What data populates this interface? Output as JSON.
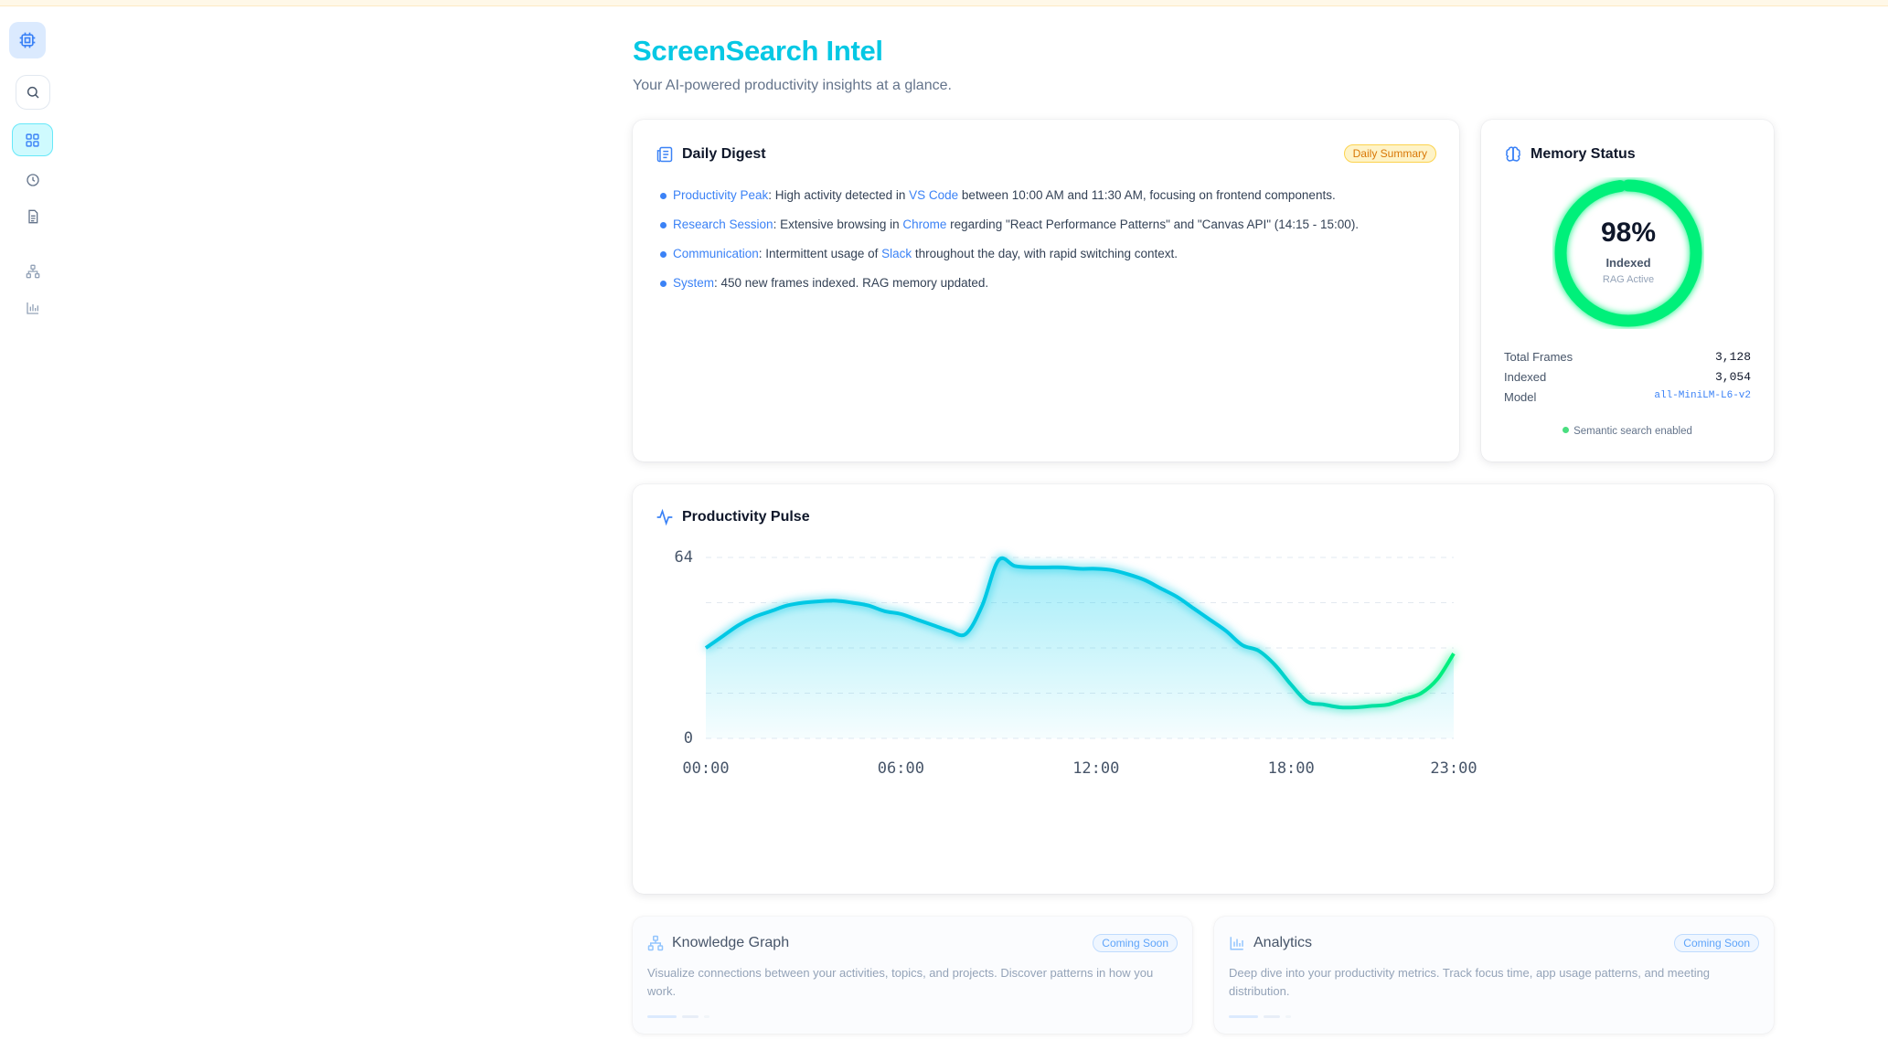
{
  "app": {
    "title": "ScreenSearch Intel",
    "subtitle": "Your AI-powered productivity insights at a glance."
  },
  "sidebar": {
    "items": [
      {
        "name": "logo",
        "icon": "chip-icon"
      },
      {
        "name": "search",
        "icon": "search-icon"
      },
      {
        "name": "dashboard",
        "icon": "grid-icon",
        "active": true
      },
      {
        "name": "history",
        "icon": "clock-icon"
      },
      {
        "name": "documents",
        "icon": "document-icon"
      },
      {
        "name": "knowledge-graph",
        "icon": "graph-icon"
      },
      {
        "name": "analytics",
        "icon": "bar-chart-icon"
      }
    ]
  },
  "digest": {
    "title": "Daily Digest",
    "badge": "Daily Summary",
    "items": [
      {
        "label": "Productivity Peak",
        "t1": ": High activity detected in ",
        "app": "VS Code",
        "t2": " between 10:00 AM and 11:30 AM, focusing on frontend components."
      },
      {
        "label": "Research Session",
        "t1": ": Extensive browsing in ",
        "app": "Chrome",
        "t2": " regarding \"React Performance Patterns\" and \"Canvas API\" (14:15 - 15:00)."
      },
      {
        "label": "Communication",
        "t1": ": Intermittent usage of ",
        "app": "Slack",
        "t2": " throughout the day, with rapid switching context."
      },
      {
        "label": "System",
        "t1": ": 450 new frames indexed. RAG memory updated.",
        "app": "",
        "t2": ""
      }
    ]
  },
  "memory": {
    "title": "Memory Status",
    "percent": "98%",
    "percent_value": 0.98,
    "ring_label": "Indexed",
    "ring_sub": "RAG Active",
    "stats": [
      {
        "label": "Total Frames",
        "value": "3,128"
      },
      {
        "label": "Indexed",
        "value": "3,054"
      },
      {
        "label": "Model",
        "value": "all-MiniLM-L6-v2"
      }
    ],
    "status": "Semantic search enabled",
    "colors": {
      "ring": "#00f07a",
      "status_dot": "#4ade80"
    }
  },
  "pulse": {
    "title": "Productivity Pulse"
  },
  "chart_data": {
    "type": "area",
    "title": "Productivity Pulse",
    "xlabel": "",
    "ylabel": "",
    "x_ticks": [
      "00:00",
      "06:00",
      "12:00",
      "18:00",
      "23:00"
    ],
    "y_ticks": [
      "64",
      "0"
    ],
    "ylim": [
      0,
      64
    ],
    "x": [
      0,
      0.5,
      1,
      1.5,
      2,
      2.5,
      3,
      3.5,
      4,
      4.5,
      5,
      5.5,
      6,
      6.5,
      7,
      7.5,
      8,
      8.5,
      9,
      9.5,
      10,
      10.5,
      11,
      11.5,
      12,
      12.5,
      13,
      13.5,
      14,
      14.5,
      15,
      15.5,
      16,
      16.5,
      17,
      17.5,
      18,
      18.5,
      19,
      19.5,
      20,
      20.5,
      21,
      21.5,
      22,
      22.5,
      23
    ],
    "series": [
      {
        "values": [
          32,
          36,
          40,
          43,
          45,
          47,
          48,
          48.5,
          48.7,
          48,
          47,
          45,
          44,
          42,
          40,
          38,
          37,
          47,
          63,
          61,
          60.5,
          60.5,
          60.5,
          60,
          60,
          59.5,
          58,
          56,
          53,
          50,
          46,
          42,
          38,
          33,
          31,
          26,
          19,
          13,
          12,
          11,
          11,
          11.5,
          12,
          14,
          16,
          21,
          30
        ],
        "color_start": "#06c8e4",
        "color_end": "#00f07a"
      }
    ],
    "grid": true
  },
  "cards": [
    {
      "title": "Knowledge Graph",
      "badge": "Coming Soon",
      "description": "Visualize connections between your activities, topics, and projects. Discover patterns in how you work."
    },
    {
      "title": "Analytics",
      "badge": "Coming Soon",
      "description": "Deep dive into your productivity metrics. Track focus time, app usage patterns, and meeting distribution."
    }
  ]
}
